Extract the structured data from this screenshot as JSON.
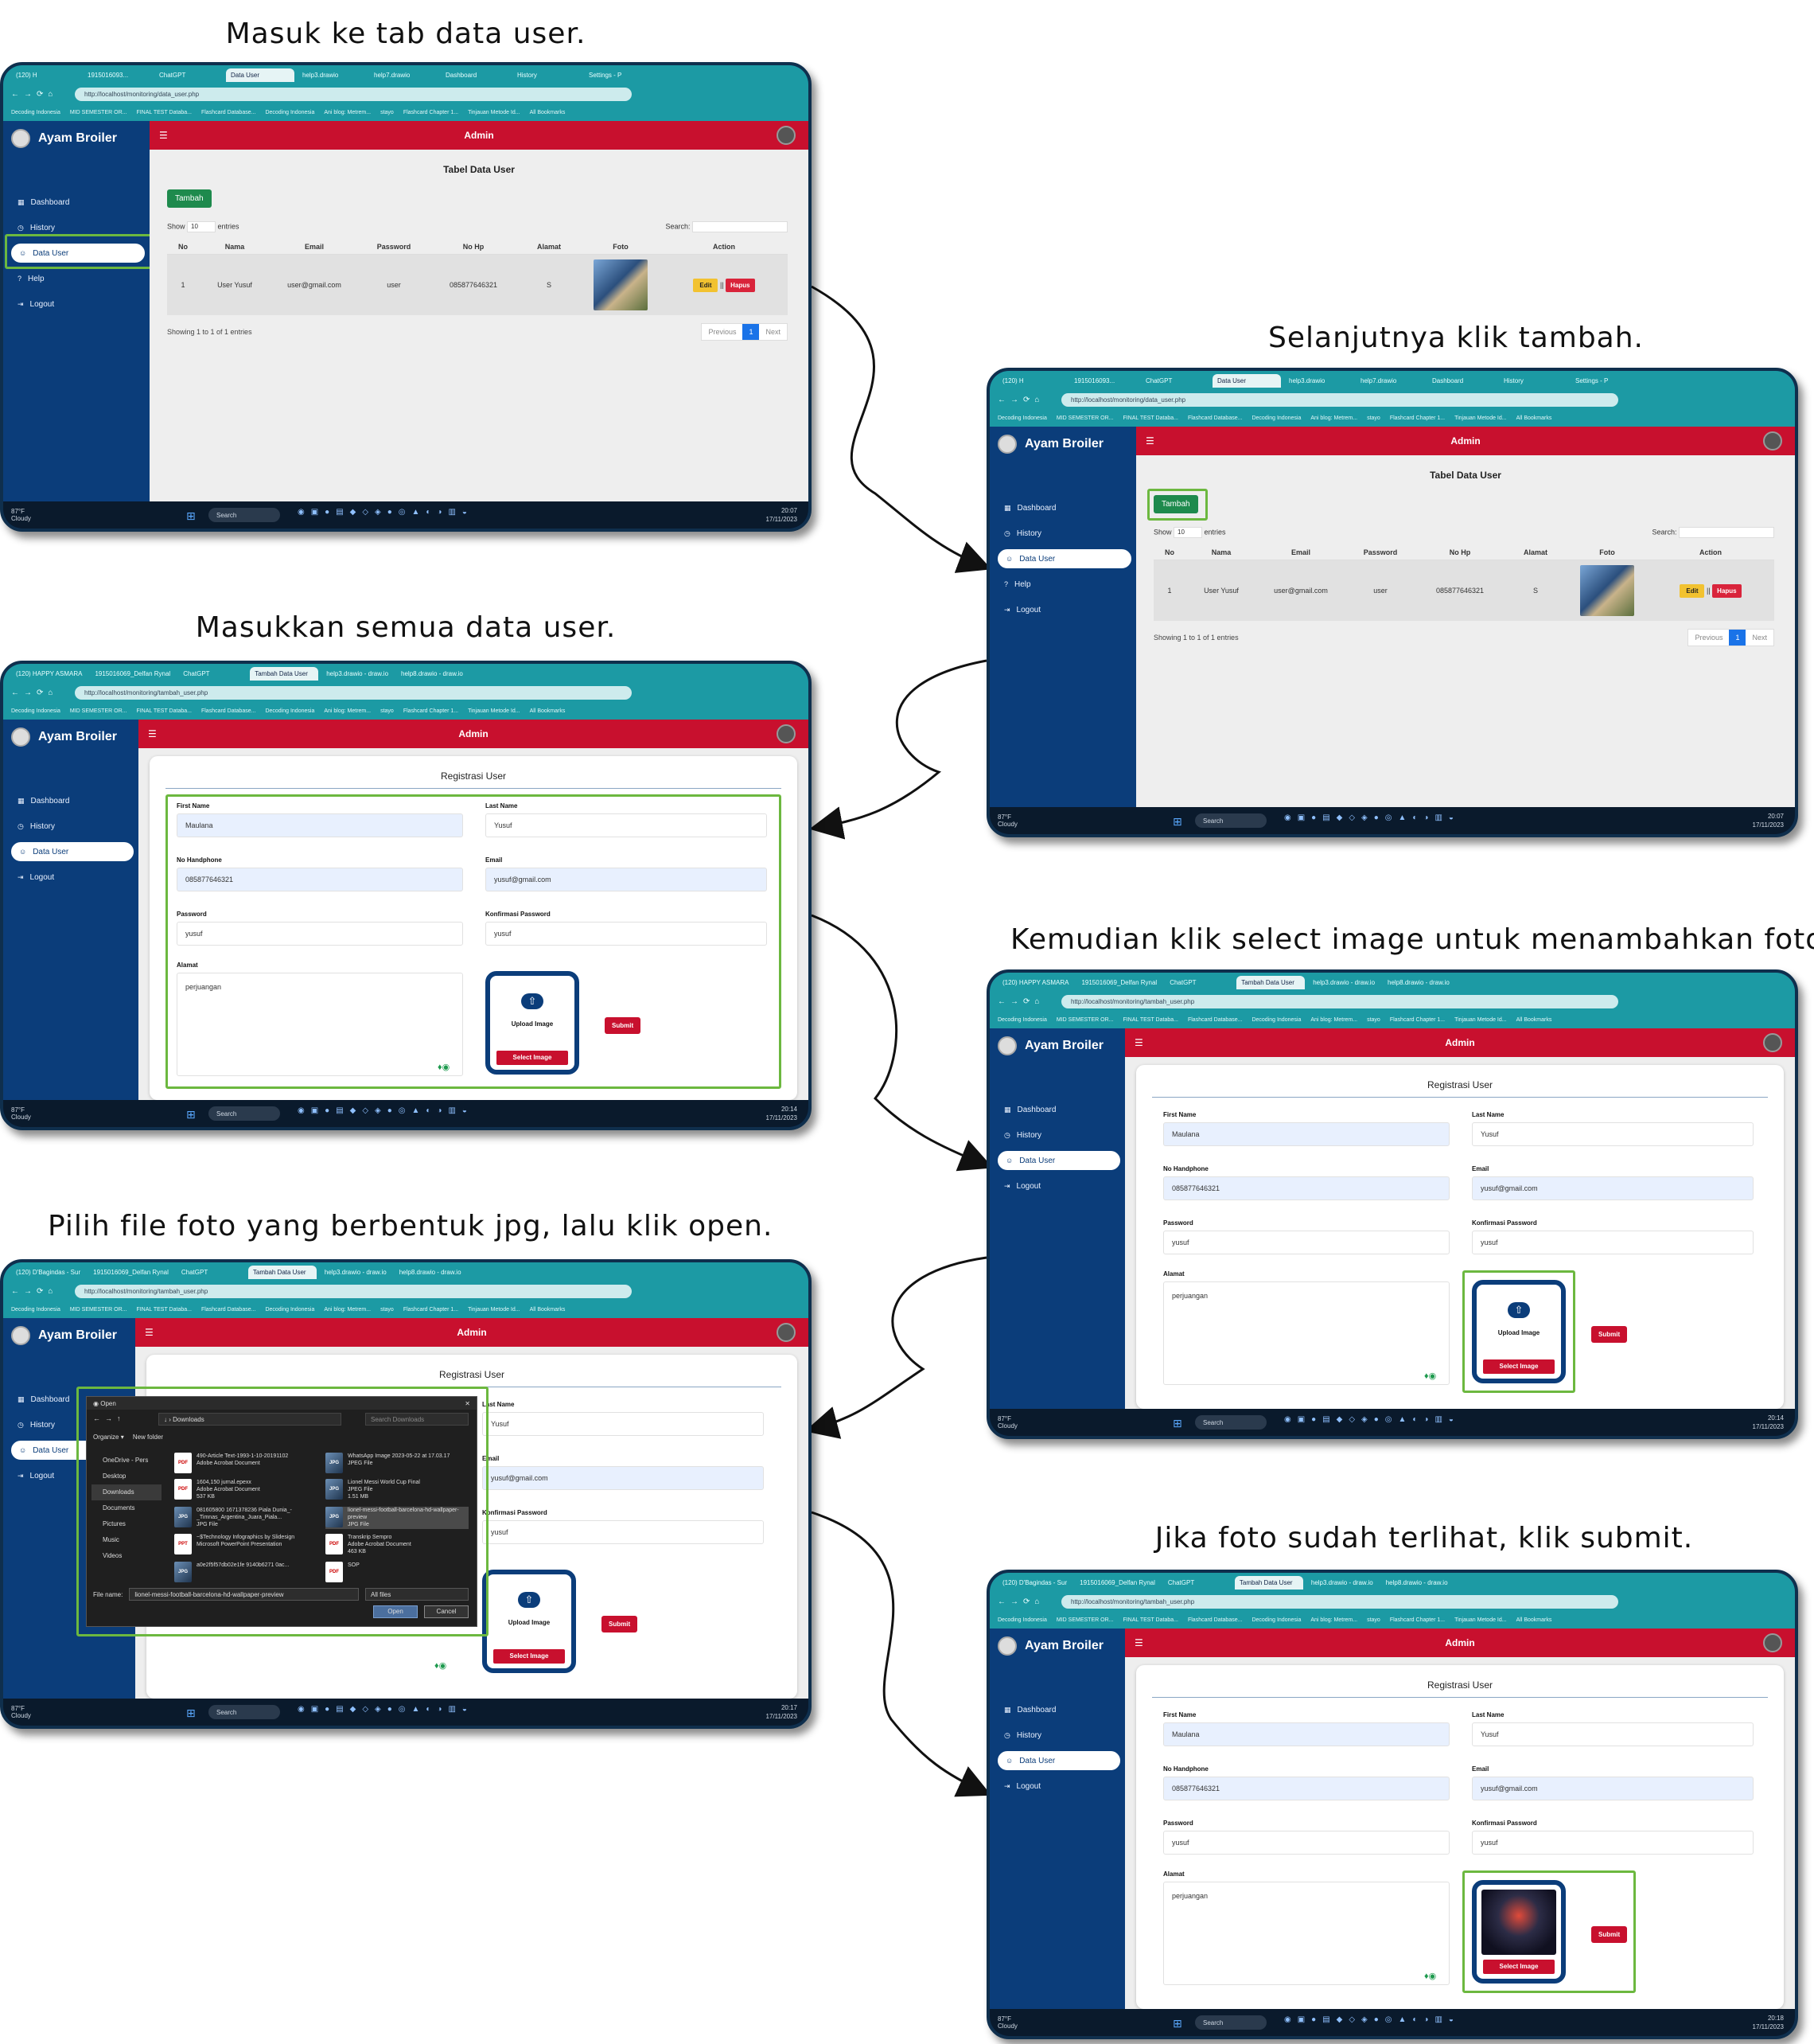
{
  "captions": {
    "step1": "Masuk ke tab data user.",
    "step2": "Selanjutnya klik tambah.",
    "step3": "Masukkan semua data user.",
    "step4": "Kemudian klik select image untuk menambahkan foto.",
    "step5": "Pilih file foto yang berbentuk jpg, lalu klik open.",
    "step6": "Jika foto sudah terlihat, klik submit."
  },
  "browser": {
    "tabs_a": [
      "(120) H",
      "1915016093...",
      "ChatGPT",
      "Data User",
      "help3.drawio",
      "help7.drawio",
      "Dashboard",
      "History",
      "Settings - P"
    ],
    "tabs_b": [
      "(120) HAPPY ASMARA",
      "1915016069_Delfan Rynal",
      "ChatGPT",
      "Tambah Data User",
      "help3.drawio - draw.io",
      "help8.drawio - draw.io"
    ],
    "tabs_c": [
      "(120) D'Bagindas - Sur",
      "1915016069_Delfan Rynal",
      "ChatGPT",
      "Tambah Data User",
      "help3.drawio - draw.io",
      "help8.drawio - draw.io"
    ],
    "url_data": "http://localhost/monitoring/data_user.php",
    "url_tambah": "http://localhost/monitoring/tambah_user.php",
    "bookmarks": [
      "Decoding Indonesia",
      "MID SEMESTER OR...",
      "FINAL TEST Databa...",
      "Flashcard Database...",
      "Decoding Indonesia",
      "Ani blog: Metrem...",
      "stayo",
      "Flashcard Chapter 1...",
      "Tinjauan Metode Id...",
      "All Bookmarks"
    ]
  },
  "app": {
    "brand": "Ayam Broiler",
    "topbar_title": "Admin",
    "menu_full": [
      "Dashboard",
      "History",
      "Data User",
      "Help",
      "Logout"
    ],
    "menu_short": [
      "Dashboard",
      "History",
      "Data User",
      "Logout"
    ]
  },
  "table": {
    "title": "Tabel Data User",
    "add_button": "Tambah",
    "show_label": "Show",
    "show_value": "10",
    "entries_label": "entries",
    "search_label": "Search:",
    "columns": [
      "No",
      "Nama",
      "Email",
      "Password",
      "No Hp",
      "Alamat",
      "Foto",
      "Action"
    ],
    "row": {
      "no": "1",
      "nama": "User Yusuf",
      "email": "user@gmail.com",
      "password": "user",
      "nohp": "085877646321",
      "alamat": "S"
    },
    "edit_label": "Edit",
    "delete_label": "Hapus",
    "info": "Showing 1 to 1 of 1 entries",
    "pager": [
      "Previous",
      "1",
      "Next"
    ]
  },
  "form": {
    "title": "Registrasi User",
    "labels": {
      "first": "First Name",
      "last": "Last Name",
      "phone": "No Handphone",
      "email": "Email",
      "password": "Password",
      "confirm": "Konfirmasi Password",
      "alamat": "Alamat"
    },
    "values": {
      "first": "Maulana",
      "last": "Yusuf",
      "phone": "085877646321",
      "email": "yusuf@gmail.com",
      "password": "yusuf",
      "confirm": "yusuf",
      "alamat": "perjuangan"
    },
    "upload_label": "Upload Image",
    "select_label": "Select Image",
    "submit_label": "Submit"
  },
  "dialog": {
    "title": "Open",
    "path": "Downloads",
    "search_placeholder": "Search Downloads",
    "organize": "Organize",
    "new_folder": "New folder",
    "sidebar": [
      "OneDrive - Pers",
      "Desktop",
      "Downloads",
      "Documents",
      "Pictures",
      "Music",
      "Videos"
    ],
    "files": [
      {
        "name": "490-Article Text-1993-1-10-20191102",
        "type": "Adobe Acrobat Document",
        "kind": "PDF"
      },
      {
        "name": "WhatsApp Image 2023-05-22 at 17.03.17",
        "type": "JPEG File",
        "kind": "JPG"
      },
      {
        "name": "1604,150 jurnal.epexx",
        "type": "Adobe Acrobat Document",
        "size": "537 KB",
        "kind": "PDF"
      },
      {
        "name": "Lionel Messi World Cup Final",
        "type": "JPEG File",
        "size": "1.51 MB",
        "kind": "JPG"
      },
      {
        "name": "081605800 1671378236 Piala Dunia_-_Timnas_Argentina_Juara_Piala...",
        "type": "JPG File",
        "kind": "JPG"
      },
      {
        "name": "lionel-messi-football-barcelona-hd-wallpaper-preview",
        "type": "JPG File",
        "kind": "JPG"
      },
      {
        "name": "~$Technology Infographics by Slidesign",
        "type": "Microsoft PowerPoint Presentation",
        "kind": "PPT"
      },
      {
        "name": "Transkrip Sempro",
        "type": "Adobe Acrobat Document",
        "size": "463 KB",
        "kind": "PDF"
      },
      {
        "name": "a0e2f5f57db02e1fe 9140b6271 0ac...",
        "type": "",
        "kind": "JPG"
      },
      {
        "name": "SOP",
        "type": "",
        "kind": "PDF"
      }
    ],
    "filename_label": "File name:",
    "filename_value": "lionel-messi-football-barcelona-hd-wallpaper-preview",
    "filter_value": "All files",
    "open_label": "Open",
    "cancel_label": "Cancel"
  },
  "taskbar": {
    "temp": "87°F",
    "weather": "Cloudy",
    "search": "Search",
    "date": "17/11/2023",
    "times": [
      "20:07",
      "20:07",
      "20:14",
      "20:14",
      "20:17",
      "20:18"
    ]
  },
  "colors": {
    "accent_red": "#c8102e",
    "sidebar_blue": "#0b3d7a",
    "chrome_teal": "#1c9aa4",
    "highlight_green": "#6cb83f",
    "tambah_green": "#1e8a4d"
  }
}
